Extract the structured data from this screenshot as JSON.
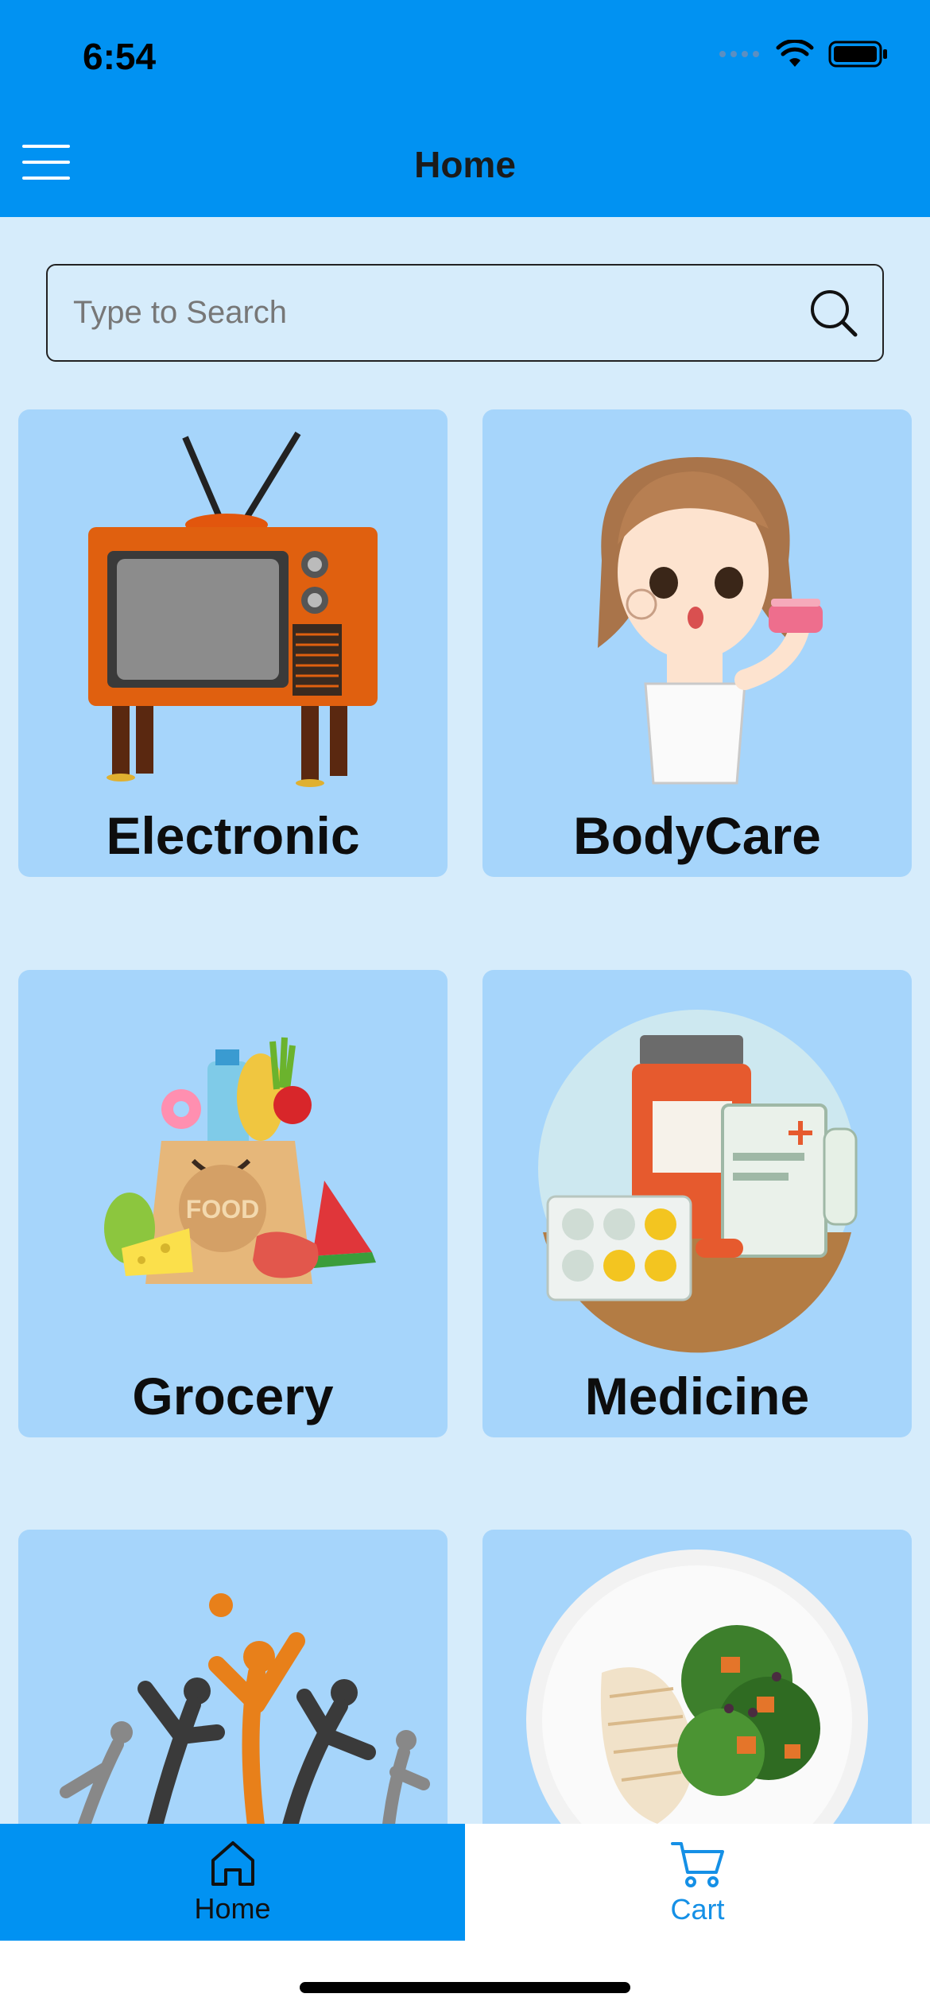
{
  "status_bar": {
    "time": "6:54"
  },
  "header": {
    "title": "Home"
  },
  "search": {
    "placeholder": "Type to Search",
    "value": ""
  },
  "categories": [
    {
      "label": "Electronic"
    },
    {
      "label": "BodyCare"
    },
    {
      "label": "Grocery"
    },
    {
      "label": "Medicine"
    },
    {
      "label": ""
    },
    {
      "label": ""
    }
  ],
  "tabs": [
    {
      "label": "Home",
      "active": true
    },
    {
      "label": "Cart",
      "active": false
    }
  ],
  "colors": {
    "primary": "#0192f2",
    "background": "#d6ecfb",
    "card": "#a6d5fb",
    "cart_tab": "#1590e6"
  },
  "icons": [
    "menu-icon",
    "search-icon",
    "home-icon",
    "cart-icon",
    "wifi-icon",
    "battery-icon",
    "signal-icon"
  ]
}
